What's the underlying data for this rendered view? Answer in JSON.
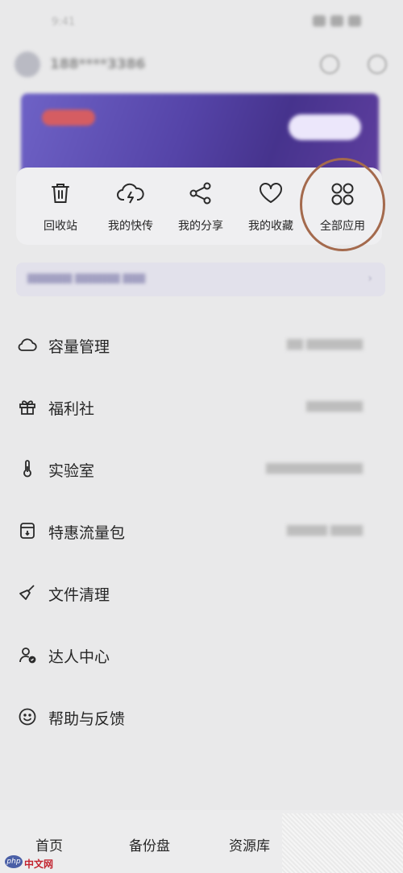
{
  "status_bar": {
    "time": "9:41"
  },
  "profile": {
    "username": "188****3386"
  },
  "quick_access": [
    {
      "label": "回收站",
      "icon": "trash-icon"
    },
    {
      "label": "我的快传",
      "icon": "cloud-lightning-icon"
    },
    {
      "label": "我的分享",
      "icon": "share-icon"
    },
    {
      "label": "我的收藏",
      "icon": "heart-icon"
    },
    {
      "label": "全部应用",
      "icon": "apps-grid-icon"
    }
  ],
  "menu": [
    {
      "label": "容量管理",
      "icon": "cloud-icon"
    },
    {
      "label": "福利社",
      "icon": "gift-icon"
    },
    {
      "label": "实验室",
      "icon": "thermometer-icon"
    },
    {
      "label": "特惠流量包",
      "icon": "data-pack-icon"
    },
    {
      "label": "文件清理",
      "icon": "broom-icon"
    },
    {
      "label": "达人中心",
      "icon": "user-badge-icon"
    },
    {
      "label": "帮助与反馈",
      "icon": "smile-icon"
    }
  ],
  "bottom_nav": [
    {
      "label": "首页"
    },
    {
      "label": "备份盘"
    },
    {
      "label": "资源库"
    }
  ],
  "watermark": {
    "badge": "php",
    "text": "中文网"
  },
  "colors": {
    "highlight_circle": "#a46a4d",
    "banner": "#5544a8"
  }
}
